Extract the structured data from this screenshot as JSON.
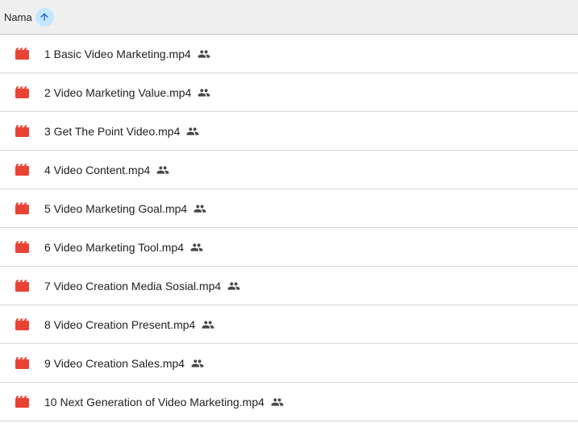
{
  "header": {
    "column_label": "Nama",
    "sort_icon": "arrow-up-icon",
    "sort_direction": "ascending"
  },
  "colors": {
    "video_icon": "#ea4335",
    "sort_badge_bg": "#c2e7ff",
    "sort_arrow": "#0b57d0"
  },
  "files": [
    {
      "name": "1 Basic Video Marketing.mp4",
      "icon": "video-file-icon",
      "shared_icon": "shared-people-icon"
    },
    {
      "name": "2 Video Marketing Value.mp4",
      "icon": "video-file-icon",
      "shared_icon": "shared-people-icon"
    },
    {
      "name": "3 Get The Point Video.mp4",
      "icon": "video-file-icon",
      "shared_icon": "shared-people-icon"
    },
    {
      "name": "4 Video Content.mp4",
      "icon": "video-file-icon",
      "shared_icon": "shared-people-icon"
    },
    {
      "name": "5 Video Marketing Goal.mp4",
      "icon": "video-file-icon",
      "shared_icon": "shared-people-icon"
    },
    {
      "name": "6 Video Marketing Tool.mp4",
      "icon": "video-file-icon",
      "shared_icon": "shared-people-icon"
    },
    {
      "name": "7 Video Creation Media Sosial.mp4",
      "icon": "video-file-icon",
      "shared_icon": "shared-people-icon"
    },
    {
      "name": "8 Video Creation Present.mp4",
      "icon": "video-file-icon",
      "shared_icon": "shared-people-icon"
    },
    {
      "name": "9 Video Creation Sales.mp4",
      "icon": "video-file-icon",
      "shared_icon": "shared-people-icon"
    },
    {
      "name": "10 Next Generation of Video Marketing.mp4",
      "icon": "video-file-icon",
      "shared_icon": "shared-people-icon"
    }
  ]
}
